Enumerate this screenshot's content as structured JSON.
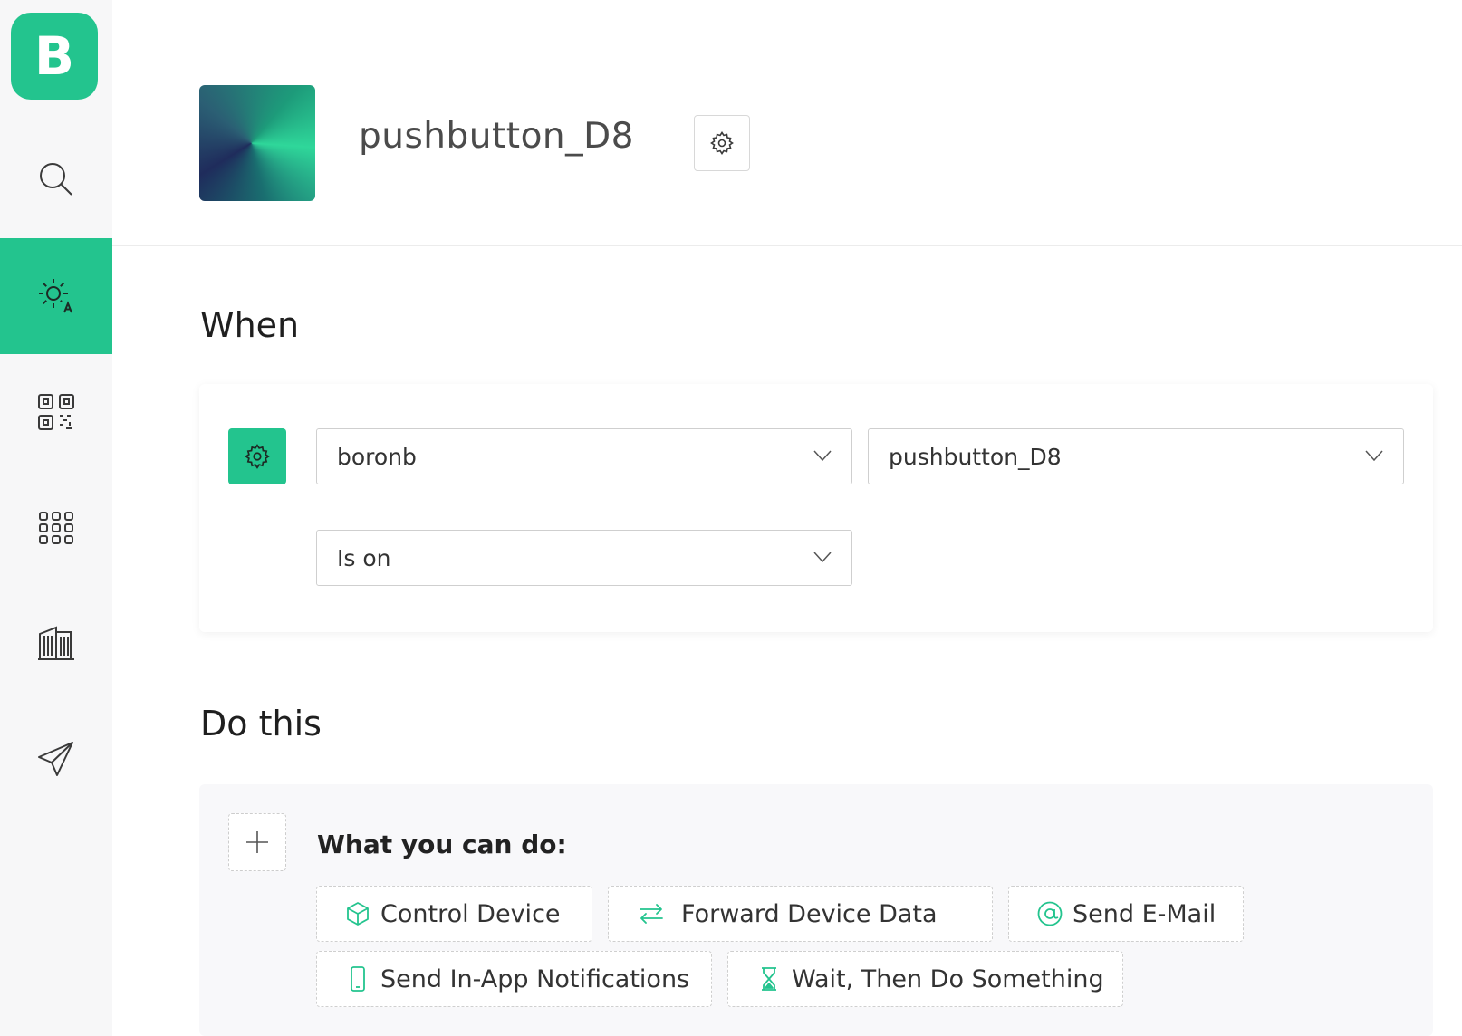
{
  "sidebar": {
    "logo_letter": "B",
    "items": [
      {
        "icon": "search-icon"
      },
      {
        "icon": "automation-icon",
        "active": true
      },
      {
        "icon": "qr-code-icon"
      },
      {
        "icon": "grid-apps-icon"
      },
      {
        "icon": "building-icon"
      },
      {
        "icon": "send-icon"
      }
    ]
  },
  "header": {
    "title": "pushbutton_D8",
    "settings_icon": "gear-icon"
  },
  "when": {
    "heading": "When",
    "device_select": "boronb",
    "datastream_select": "pushbutton_D8",
    "condition_select": "Is on"
  },
  "do_this": {
    "heading": "Do this",
    "what_you_can_do": "What you can do:",
    "actions": [
      {
        "label": "Control Device",
        "icon": "cube-icon"
      },
      {
        "label": "Forward Device Data",
        "icon": "arrows-exchange-icon"
      },
      {
        "label": "Send E-Mail",
        "icon": "at-sign-icon"
      },
      {
        "label": "Send In-App Notifications",
        "icon": "phone-icon"
      },
      {
        "label": "Wait, Then Do Something",
        "icon": "hourglass-icon"
      }
    ]
  },
  "colors": {
    "accent": "#23c48e",
    "sidebar_bg": "#f7f7f8"
  }
}
